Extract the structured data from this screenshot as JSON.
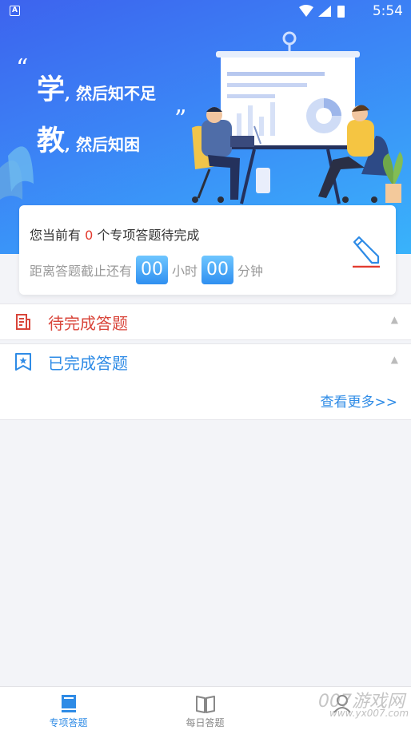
{
  "status_bar": {
    "time": "5:54",
    "app_icon_letter": "A"
  },
  "banner": {
    "slogan_line1_big": "学",
    "slogan_line1_rest": ", 然后知不足",
    "slogan_line2_big": "教",
    "slogan_line2_rest": ", 然后知困",
    "open_quote": "“",
    "close_quote": "”"
  },
  "summary_card": {
    "pending_prefix": "您当前有",
    "pending_count": "0",
    "pending_suffix": "个专项答题待完成",
    "deadline_prefix": "距离答题截止还有",
    "hours": "00",
    "hours_unit": "小时",
    "minutes": "00",
    "minutes_unit": "分钟"
  },
  "sections": {
    "pending": {
      "title": "待完成答题",
      "color": "#d9453a"
    },
    "completed": {
      "title": "已完成答题",
      "color": "#2e8be6",
      "more_label": "查看更多>>"
    }
  },
  "bottom_nav": {
    "items": [
      {
        "label": "专项答题",
        "icon": "book-icon",
        "active": true
      },
      {
        "label": "每日答题",
        "icon": "open-book-icon",
        "active": false
      },
      {
        "label": "",
        "icon": "profile-icon",
        "active": false
      }
    ],
    "active_color": "#2e8be6",
    "inactive_color": "#888888"
  },
  "watermark": {
    "text": "007游戏网",
    "url": "www.yx007.com"
  }
}
